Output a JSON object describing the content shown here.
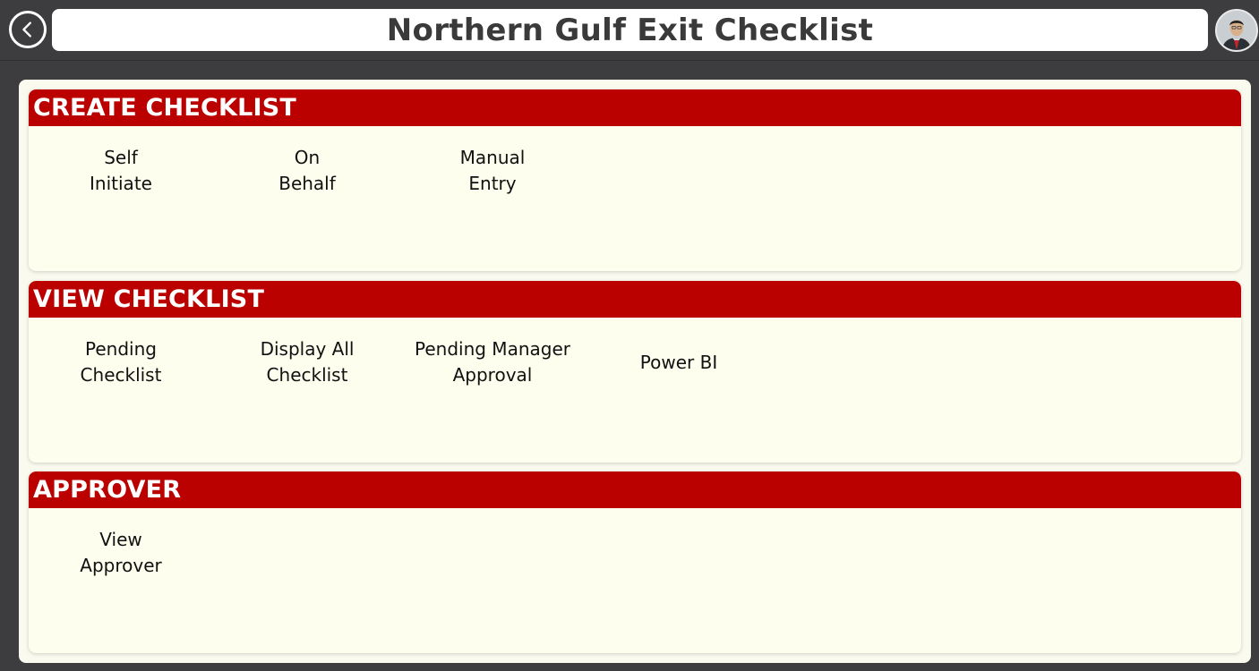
{
  "header": {
    "title": "Northern Gulf Exit Checklist",
    "back_icon": "chevron-left-icon",
    "avatar_icon": "user-avatar"
  },
  "colors": {
    "background": "#3d3d3f",
    "section_header": "#bb0000",
    "panel": "#fafaef"
  },
  "sections": [
    {
      "title": "CREATE CHECKLIST",
      "tiles": [
        {
          "label": "Self\nInitiate"
        },
        {
          "label": "On\nBehalf"
        },
        {
          "label": "Manual\nEntry"
        }
      ]
    },
    {
      "title": "VIEW CHECKLIST",
      "tiles": [
        {
          "label": "Pending\nChecklist"
        },
        {
          "label": "Display All\nChecklist"
        },
        {
          "label": "Pending Manager\nApproval"
        },
        {
          "label": "Power BI"
        }
      ]
    },
    {
      "title": "APPROVER",
      "tiles": [
        {
          "label": "View\nApprover"
        }
      ]
    }
  ]
}
